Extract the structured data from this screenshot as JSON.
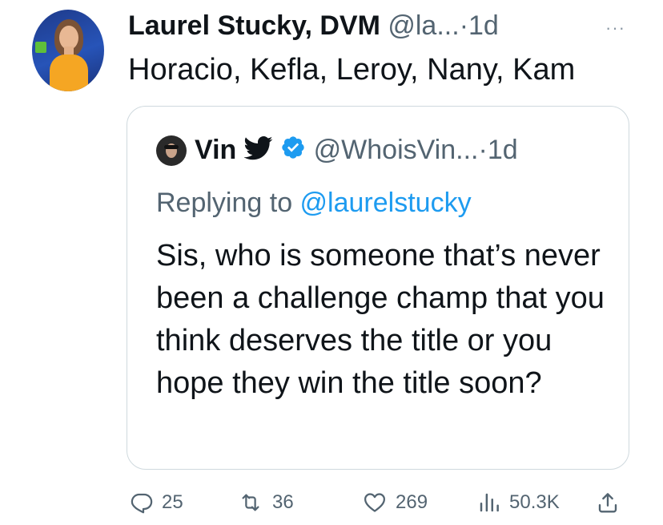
{
  "tweet": {
    "author_name": "Laurel Stucky, DVM",
    "handle": "@la...",
    "separator": "·",
    "time": "1d",
    "more": "···",
    "text": "Horacio, Kefla, Leroy, Nany, Kam"
  },
  "quote": {
    "author_name": "Vin",
    "handle": "@WhoisVin...",
    "separator": "·",
    "time": "1d",
    "replying_prefix": "Replying to ",
    "replying_mention": "@laurelstucky",
    "text": "Sis, who is someone that’s never been a challenge champ that you think deserves the title or you hope they win the title soon?"
  },
  "actions": {
    "replies": "25",
    "retweets": "36",
    "likes": "269",
    "views": "50.3K"
  },
  "icons": [
    "avatar",
    "bird-icon",
    "verified-badge-icon",
    "reply-icon",
    "retweet-icon",
    "like-icon",
    "views-icon",
    "share-icon"
  ],
  "colors": {
    "link": "#1d9bf0",
    "verified": "#1d9bf0",
    "secondary_text": "#536471",
    "border": "#cfd9de"
  }
}
